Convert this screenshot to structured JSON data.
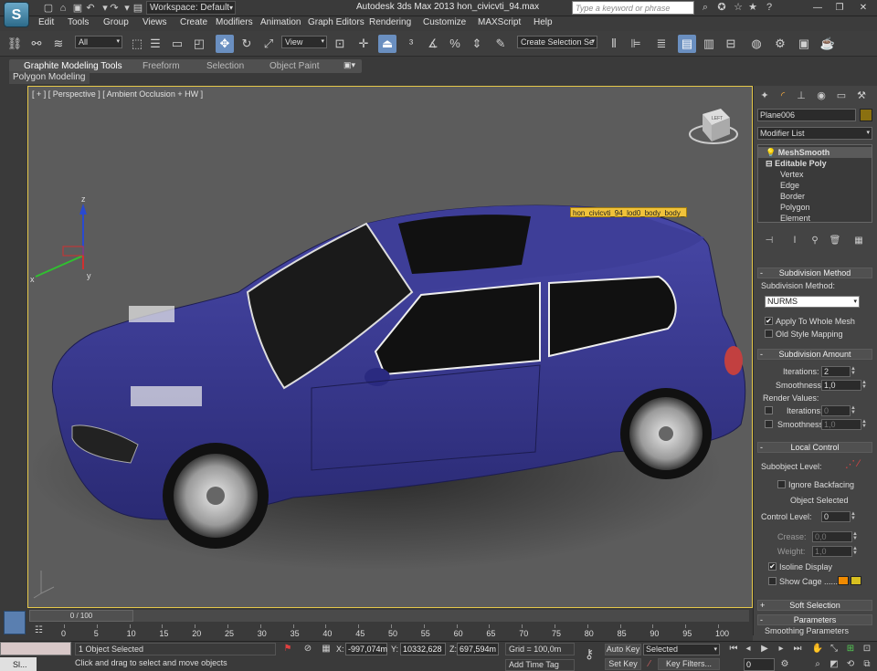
{
  "window": {
    "app_logo": "S",
    "title": "Autodesk 3ds Max  2013       hon_civicvti_94.max",
    "workspace": "Workspace: Default",
    "search_placeholder": "Type a keyword or phrase"
  },
  "menu": [
    "Edit",
    "Tools",
    "Group",
    "Views",
    "Create",
    "Modifiers",
    "Animation",
    "Graph Editors",
    "Rendering",
    "Customize",
    "MAXScript",
    "Help"
  ],
  "toolbar": {
    "selection_filter": "All",
    "ref_coord": "View",
    "named_selection": "Create Selection Se"
  },
  "ribbon": {
    "tabs": [
      "Graphite Modeling Tools",
      "Freeform",
      "Selection",
      "Object Paint"
    ],
    "panel": "Polygon Modeling"
  },
  "viewport": {
    "label": "[ + ] [ Perspective ] [ Ambient Occlusion + HW ]",
    "object_tag": "hon_civicvti_94_lod0_body_body_",
    "axis_x": "x",
    "axis_y": "y",
    "axis_z": "z",
    "viewcube_label": "LEFT",
    "car_body_color": "#3a3a8c"
  },
  "command_panel": {
    "object_name": "Plane006",
    "object_color": "#8a7010",
    "modifier_list": "Modifier List",
    "stack": [
      "MeshSmooth",
      "Editable Poly",
      "Vertex",
      "Edge",
      "Border",
      "Polygon",
      "Element"
    ],
    "subdivision_method": {
      "title": "Subdivision Method",
      "label": "Subdivision Method:",
      "value": "NURMS",
      "apply_whole_mesh": "Apply To Whole Mesh",
      "old_style": "Old Style Mapping"
    },
    "subdivision_amount": {
      "title": "Subdivision Amount",
      "iterations_label": "Iterations:",
      "iterations": "2",
      "smoothness_label": "Smoothness:",
      "smoothness": "1,0",
      "render_values": "Render Values:",
      "r_iterations_label": "Iterations:",
      "r_iterations": "0",
      "r_smoothness_label": "Smoothness:",
      "r_smoothness": "1,0"
    },
    "local_control": {
      "title": "Local Control",
      "subobject_level": "Subobject Level:",
      "ignore_backfacing": "Ignore Backfacing",
      "object_selected": "Object Selected",
      "control_level_label": "Control Level:",
      "control_level": "0",
      "crease_label": "Crease:",
      "crease": "0,0",
      "weight_label": "Weight:",
      "weight": "1,0",
      "isoline": "Isoline Display",
      "show_cage": "Show Cage ......",
      "cage_color_1": "#f08a00",
      "cage_color_2": "#d8c020"
    },
    "soft_selection": "Soft Selection",
    "parameters": "Parameters",
    "smoothing_parameters": "Smoothing Parameters"
  },
  "timeline": {
    "frame": "0 / 100",
    "ticks": [
      "0",
      "5",
      "10",
      "15",
      "20",
      "25",
      "30",
      "35",
      "40",
      "45",
      "50",
      "55",
      "60",
      "65",
      "70",
      "75",
      "80",
      "85",
      "90",
      "95",
      "100"
    ]
  },
  "status": {
    "taskbar_label": "Sl...",
    "selected": "1 Object Selected",
    "prompt": "Click and drag to select and move objects",
    "x_label": "X:",
    "x": "-997,074m",
    "y_label": "Y:",
    "y": "10332,628",
    "z_label": "Z:",
    "z": "697,594m",
    "grid": "Grid = 100,0m",
    "add_time_tag": "Add Time Tag",
    "auto_key": "Auto Key",
    "set_key": "Set Key",
    "key_mode": "Selected",
    "key_filters": "Key Filters...",
    "frame_field": "0"
  }
}
